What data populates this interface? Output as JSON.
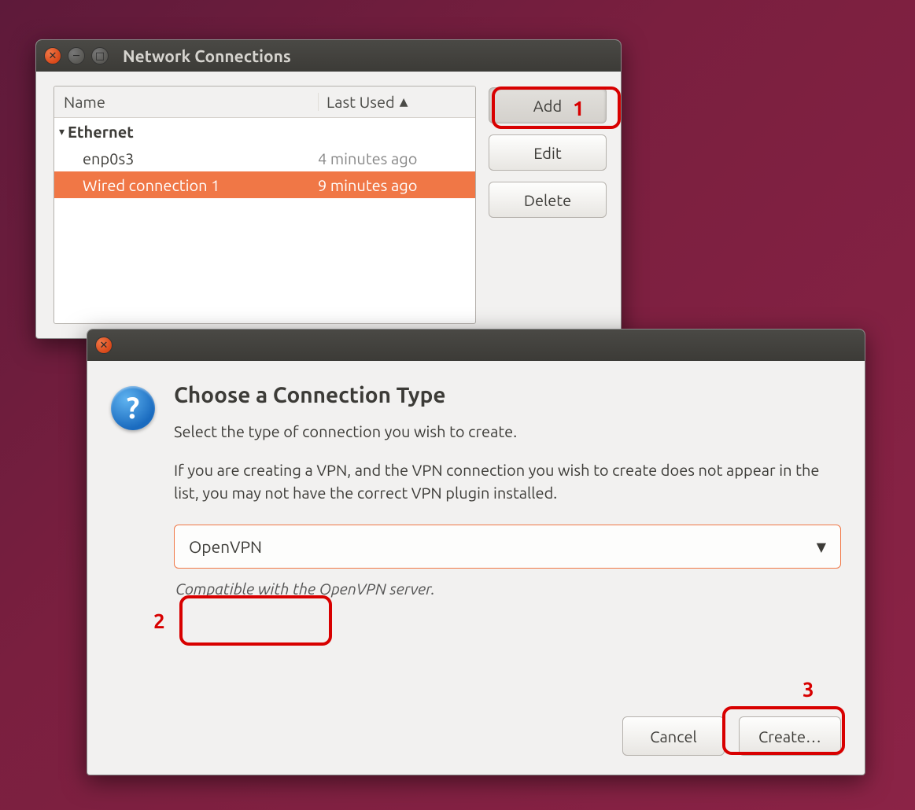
{
  "nc_window": {
    "title": "Network Connections",
    "columns": {
      "name": "Name",
      "last_used": "Last Used"
    },
    "group_label": "Ethernet",
    "rows": [
      {
        "name": "enp0s3",
        "last_used": "4 minutes ago",
        "selected": false
      },
      {
        "name": "Wired connection 1",
        "last_used": "9 minutes ago",
        "selected": true
      }
    ],
    "buttons": {
      "add": "Add",
      "edit": "Edit",
      "delete": "Delete"
    }
  },
  "dialog": {
    "heading": "Choose a Connection Type",
    "line1": "Select the type of connection you wish to create.",
    "line2": "If you are creating a VPN, and the VPN connection you wish to create does not appear in the list, you may not have the correct VPN plugin installed.",
    "combo_value": "OpenVPN",
    "hint": "Compatible with the OpenVPN server.",
    "buttons": {
      "cancel": "Cancel",
      "create": "Create…"
    }
  },
  "annotations": {
    "n1": "1",
    "n2": "2",
    "n3": "3"
  },
  "colors": {
    "accent": "#f07746",
    "highlight": "#d80000"
  }
}
